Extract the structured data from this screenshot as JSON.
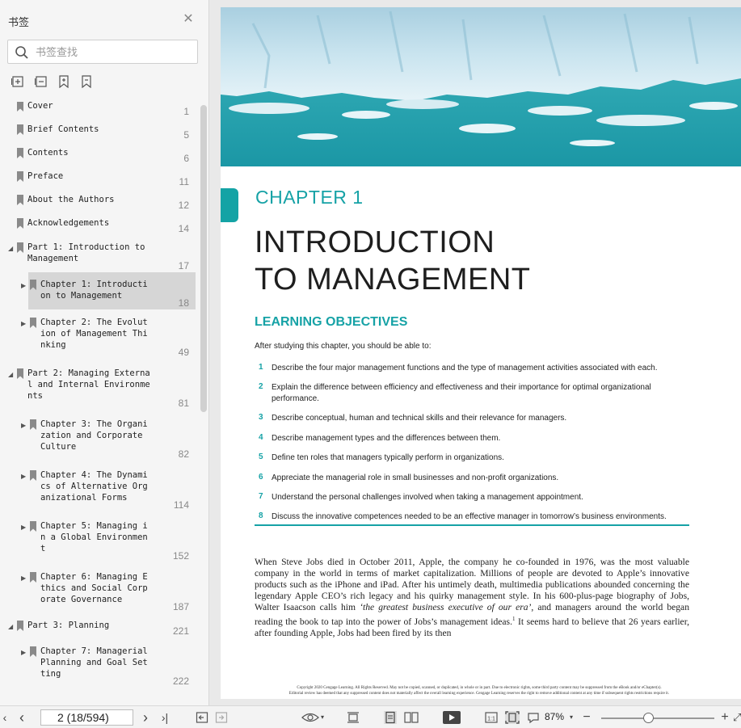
{
  "sidebar": {
    "title": "书签",
    "search_placeholder": "书签查找",
    "bookmarks": [
      {
        "label": "Cover",
        "page": "1",
        "top": 0,
        "lh": 30
      },
      {
        "label": "Brief Contents",
        "page": "5"
      },
      {
        "label": "Contents",
        "page": "6"
      },
      {
        "label": "Preface",
        "page": "11"
      },
      {
        "label": "About the Authors",
        "page": "12"
      },
      {
        "label": "Acknowledgements",
        "page": "14"
      },
      {
        "label": "Part 1: Introduction to\nManagement",
        "page": "17"
      },
      {
        "label": "Chapter 1: Introducti\non to Management",
        "page": "18"
      },
      {
        "label": "Chapter 2: The Evolut\nion of Management Thi\nnking",
        "page": "49"
      },
      {
        "label": "Part 2: Managing Externa\nl and Internal Environme\nnts",
        "page": "81"
      },
      {
        "label": "Chapter 3: The Organi\nzation and Corporate\nCulture",
        "page": "82"
      },
      {
        "label": "Chapter 4: The Dynami\ncs of Alternative Org\nanizational Forms",
        "page": "114"
      },
      {
        "label": "Chapter 5: Managing i\nn a Global Environmen\nt",
        "page": "152"
      },
      {
        "label": "Chapter 6: Managing E\nthics and Social Corp\norate Governance",
        "page": "187"
      },
      {
        "label": "Part 3: Planning",
        "page": "221"
      },
      {
        "label": "Chapter 7: Managerial\nPlanning and Goal Set\nting",
        "page": "222"
      }
    ]
  },
  "document": {
    "chapter_label": "CHAPTER 1",
    "title_line1": "INTRODUCTION",
    "title_line2": "TO MANAGEMENT",
    "objectives_heading": "LEARNING OBJECTIVES",
    "objectives_intro": "After studying this chapter, you should be able to:",
    "objectives": [
      {
        "num": "1",
        "text": "Describe the four major management functions and the type of management activities associated with each."
      },
      {
        "num": "2",
        "text": "Explain the difference between efficiency and effectiveness and their importance for optimal organizational performance."
      },
      {
        "num": "3",
        "text": "Describe conceptual, human and technical skills and their relevance for managers."
      },
      {
        "num": "4",
        "text": "Describe management types and the differences between them."
      },
      {
        "num": "5",
        "text": "Define ten roles that managers typically perform in organizations."
      },
      {
        "num": "6",
        "text": "Appreciate the managerial role in small businesses and non-profit organizations."
      },
      {
        "num": "7",
        "text": "Understand the personal challenges involved when taking a management appointment."
      },
      {
        "num": "8",
        "text": "Discuss the innovative competences needed to be an effective manager in tomorrow’s business environments."
      }
    ],
    "body_part1": "When Steve Jobs died in October 2011, Apple, the company he co-founded in 1976, was the most valuable company in the world in terms of market capitalization. Millions of people are devoted to Apple’s innovative products such as the iPhone and iPad. After his untimely death, multimedia publications abounded concerning the legendary Apple CEO’s rich legacy and his quirky management style. In his 600-plus-page biography of Jobs, Walter Isaacson calls him ",
    "body_italic": "‘the greatest business executive of our era’",
    "body_part2": ", and managers around the world began reading the book to tap into the power of Jobs’s management ideas.",
    "body_footnote": "1",
    "body_part3": " It seems hard to believe that 26 years earlier, after founding Apple, Jobs had been fired by its then",
    "copyright_line1": "Copyright 2020 Cengage Learning. All Rights Reserved. May not be copied, scanned, or duplicated, in whole or in part. Due to electronic rights, some third party content may be suppressed from the eBook and/or eChapter(s).",
    "copyright_line2": "Editorial review has deemed that any suppressed content does not materially affect the overall learning experience. Cengage Learning reserves the right to remove additional content at any time if subsequent rights restrictions require it."
  },
  "toolbar": {
    "page_value": "2 (18/594)",
    "zoom": "87%"
  }
}
